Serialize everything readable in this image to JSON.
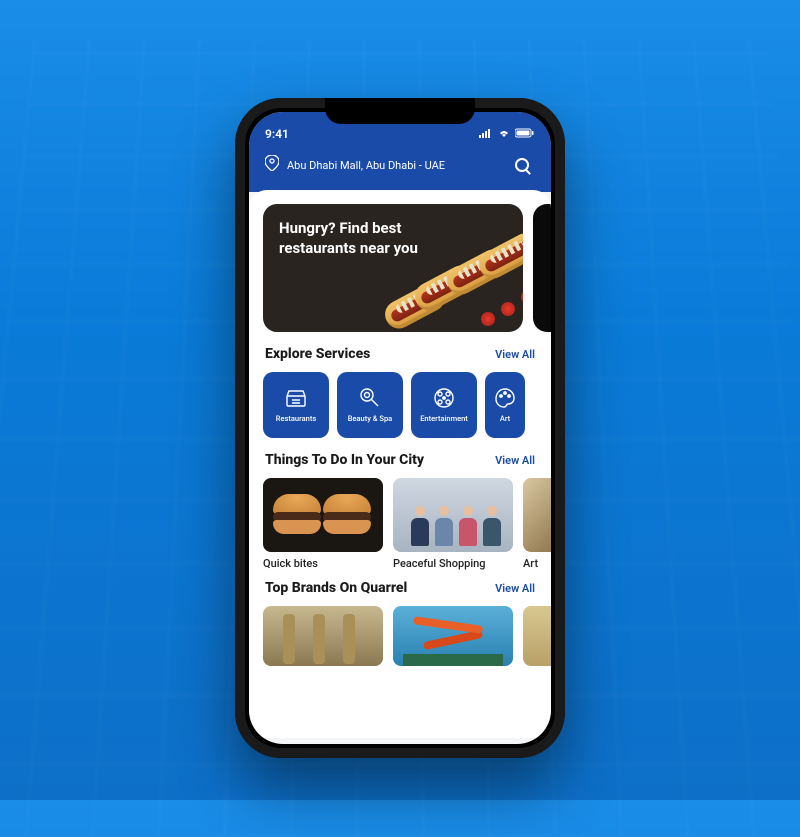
{
  "status": {
    "time": "9:41"
  },
  "header": {
    "location": "Abu Dhabi Mall, Abu Dhabi - UAE"
  },
  "hero": {
    "text": "Hungry? Find best restaurants near you"
  },
  "explore": {
    "title": "Explore Services",
    "view_all": "View All",
    "tiles": [
      {
        "label": "Restaurants"
      },
      {
        "label": "Beauty & Spa"
      },
      {
        "label": "Entertainment"
      },
      {
        "label": "Art"
      }
    ]
  },
  "things": {
    "title": "Things To Do In Your City",
    "view_all": "View All",
    "cards": [
      {
        "label": "Quick bites"
      },
      {
        "label": "Peaceful Shopping"
      },
      {
        "label": "Art"
      }
    ]
  },
  "brands": {
    "title": "Top Brands On Quarrel",
    "view_all": "View All"
  },
  "colors": {
    "primary": "#1a4ba8"
  }
}
